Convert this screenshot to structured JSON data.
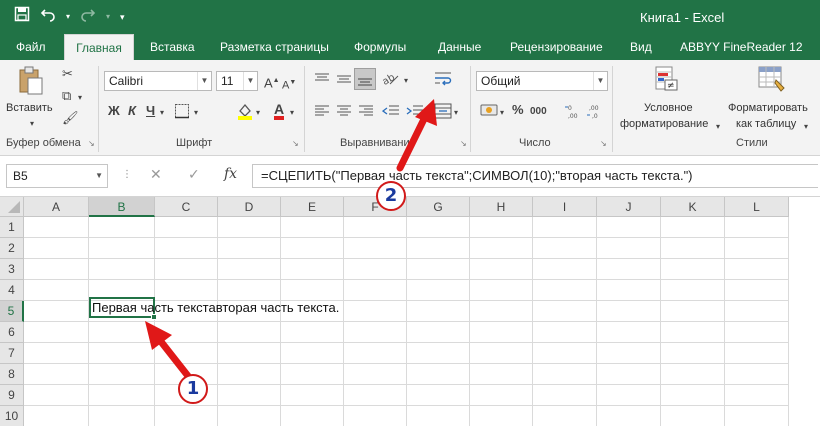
{
  "window": {
    "title": "Книга1 - Excel"
  },
  "qat": {
    "save_icon": "save-icon",
    "undo_icon": "undo-icon",
    "redo_icon": "redo-icon",
    "customize_icon": "customize-qat-icon"
  },
  "tabs": [
    "Файл",
    "Главная",
    "Вставка",
    "Разметка страницы",
    "Формулы",
    "Данные",
    "Рецензирование",
    "Вид",
    "ABBYY FineReader 12"
  ],
  "ribbon": {
    "clipboard": {
      "paste_label": "Вставить",
      "group_label": "Буфер обмена"
    },
    "font": {
      "name": "Calibri",
      "size": "11",
      "bold": "Ж",
      "italic": "К",
      "underline": "Ч",
      "grow": "A",
      "shrink": "A",
      "fontcolor": "A",
      "group_label": "Шрифт"
    },
    "alignment": {
      "group_label": "Выравнивание"
    },
    "number": {
      "format": "Общий",
      "currency": "%",
      "percent": "000",
      "group_label": "Число"
    },
    "styles": {
      "conditional_1": "Условное",
      "conditional_2": "форматирование",
      "format_table_1": "Форматировать",
      "format_table_2": "как таблицу",
      "group_label": "Стили"
    }
  },
  "formula_bar": {
    "name_box": "B5",
    "cancel_symbol": "✕",
    "enter_symbol": "✓",
    "fx_symbol": "fx",
    "formula": "=СЦЕПИТЬ(\"Первая часть текста\";СИМВОЛ(10);\"вторая часть текста.\")"
  },
  "grid": {
    "columns": [
      "A",
      "B",
      "C",
      "D",
      "E",
      "F",
      "G",
      "H",
      "I",
      "J",
      "K",
      "L"
    ],
    "rows": [
      "1",
      "2",
      "3",
      "4",
      "5",
      "6",
      "7",
      "8",
      "9",
      "10"
    ],
    "selected_column": "B",
    "selected_row": "5",
    "active_cell": "B5",
    "active_cell_text": "Первая часть текставторая часть текста."
  },
  "annotations": [
    {
      "label": "1",
      "color": "#d11a1a"
    },
    {
      "label": "2",
      "color": "#d11a1a"
    }
  ],
  "colors": {
    "accent": "#217346",
    "arrow": "#e01818",
    "badge_text": "#1a3a9e"
  }
}
